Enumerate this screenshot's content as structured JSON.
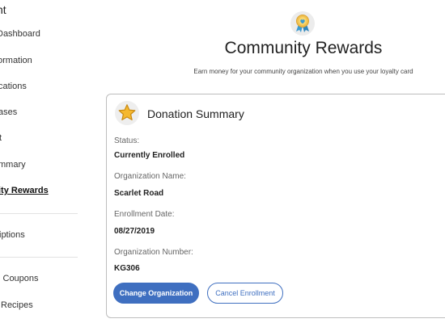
{
  "sidebar": {
    "title": "nt",
    "items": [
      {
        "label": "Dashboard",
        "active": false
      },
      {
        "label": "ormation",
        "active": false
      },
      {
        "label": "cations",
        "active": false
      },
      {
        "label": "ases",
        "active": false
      },
      {
        "label": "t",
        "active": false
      },
      {
        "label": "mmary",
        "active": false
      },
      {
        "label": "ity Rewards",
        "active": true
      },
      {
        "label": "iptions",
        "active": false
      },
      {
        "label": "l Coupons",
        "active": false
      },
      {
        "label": "Recipes",
        "active": false
      }
    ]
  },
  "header": {
    "icon": "award-ribbon-icon",
    "title": "Community Rewards",
    "subtitle": "Earn money for your community organization when you use your loyalty card"
  },
  "card": {
    "icon": "star-icon",
    "title": "Donation Summary",
    "fields": [
      {
        "label": "Status:",
        "value": "Currently Enrolled"
      },
      {
        "label": "Organization Name:",
        "value": "Scarlet Road"
      },
      {
        "label": "Enrollment Date:",
        "value": "08/27/2019"
      },
      {
        "label": "Organization Number:",
        "value": "KG306"
      }
    ],
    "buttons": {
      "primary": "Change Organization",
      "secondary": "Cancel Enrollment"
    }
  },
  "colors": {
    "accent": "#3f6fc0",
    "star": "#f5b82e",
    "award": "#f2c14e",
    "award_ribbon": "#3b9bd1"
  }
}
